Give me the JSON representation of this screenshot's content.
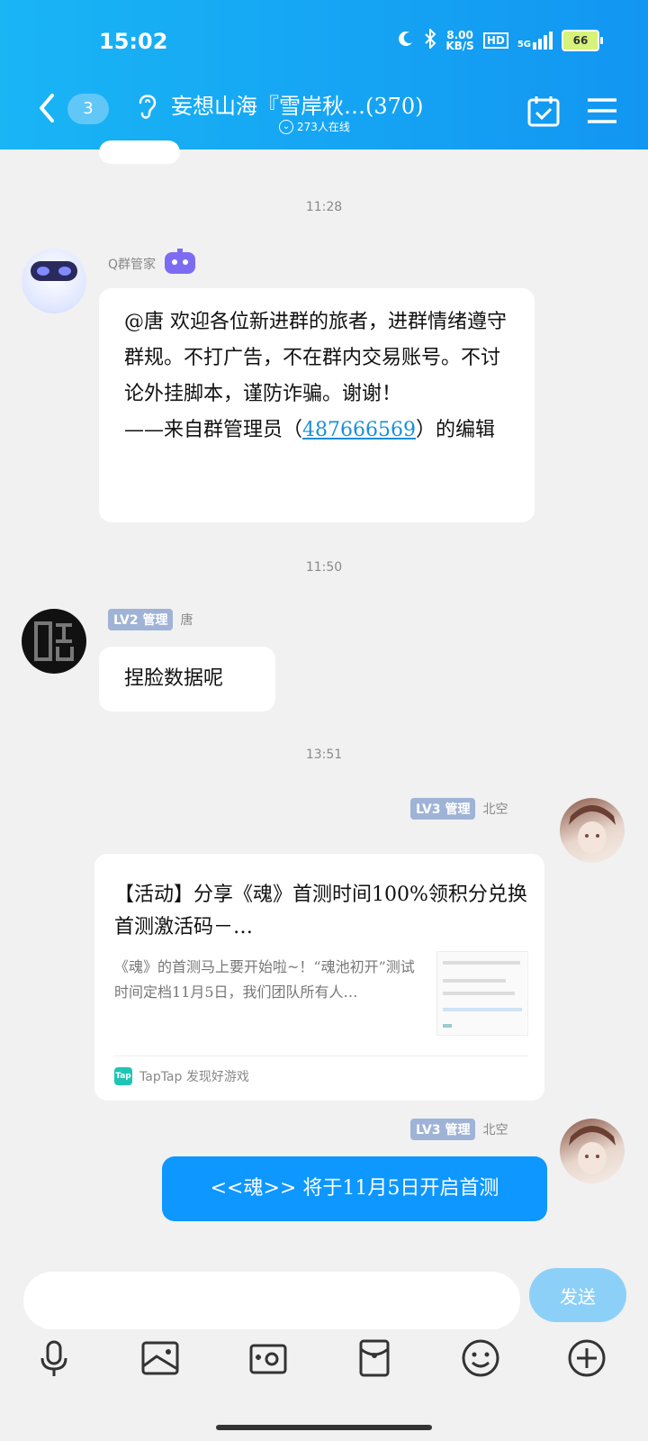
{
  "status_bar": {
    "time": "15:02",
    "network_speed": "8.00",
    "network_unit": "KB/S",
    "hd": "HD",
    "signal": "5G",
    "battery": "66"
  },
  "header": {
    "unread_count": "3",
    "group_title": "妄想山海『雪岸秋…(370)",
    "online_count": "273人在线"
  },
  "messages": {
    "sep1": "11:28",
    "m1_sender": "Q群管家",
    "m1_text_part1": "@唐 欢迎各位新进群的旅者，进群情绪遵守群规。不打广告，不在群内交易账号。不讨论外挂脚本，谨防诈骗。谢谢！",
    "m1_text_part2": "——来自群管理员（",
    "m1_link": "487666569",
    "m1_text_part3": "）的编辑",
    "sep2": "11:50",
    "m2_level": "LV2 管理",
    "m2_sender": "唐",
    "m2_text": "捏脸数据呢",
    "sep3": "13:51",
    "m3_level": "LV3 管理",
    "m3_sender": "北空",
    "m3_card_title": "【活动】分享《魂》首测时间100%领积分兑换首测激活码－…",
    "m3_card_desc": "《魂》的首测马上要开始啦~！“魂池初开”测试时间定档11月5日，我们团队所有人…",
    "m3_card_source": "TapTap 发现好游戏",
    "m3_card_logo": "Tap",
    "m4_level": "LV3 管理",
    "m4_sender": "北空",
    "m4_text": "<<魂>> 将于11月5日开启首测"
  },
  "input": {
    "send_label": "发送"
  },
  "colors": {
    "header_blue": "#1296f2",
    "bubble_blue": "#0d97ff",
    "level_badge": "#9fb3d6",
    "send_button": "#8cd0f8"
  }
}
